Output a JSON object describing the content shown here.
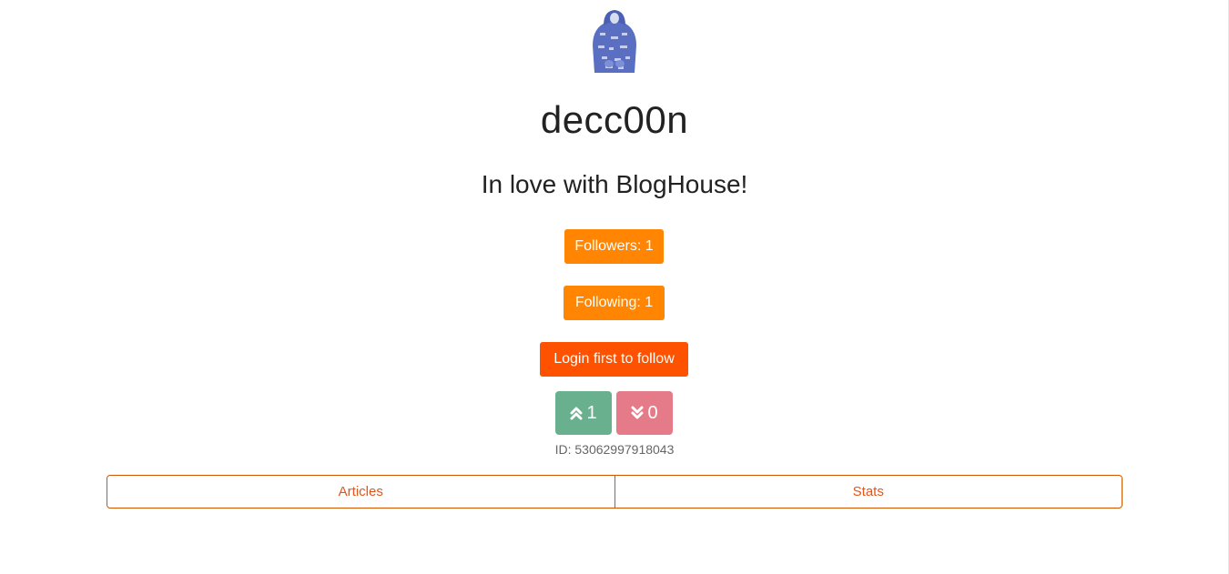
{
  "profile": {
    "avatar_icon": "user-avatar-hoodie-image",
    "username": "decc00n",
    "bio": "In love with BlogHouse!"
  },
  "buttons": {
    "followers": "Followers: 1",
    "following": "Following: 1",
    "login_to_follow": "Login first to follow"
  },
  "votes": {
    "upvote_icon": "double-chevron-up-icon",
    "upvote_count": "1",
    "downvote_icon": "double-chevron-down-icon",
    "downvote_count": "0"
  },
  "user_id": "ID: 53062997918043",
  "tabs": [
    {
      "label": "Articles"
    },
    {
      "label": "Stats"
    }
  ],
  "colors": {
    "orange": "#ff8503",
    "login_orange": "#fe5201",
    "upvote_green": "#69b08f",
    "downvote_pink": "#e57b89",
    "tab_accent": "#e0561d"
  }
}
